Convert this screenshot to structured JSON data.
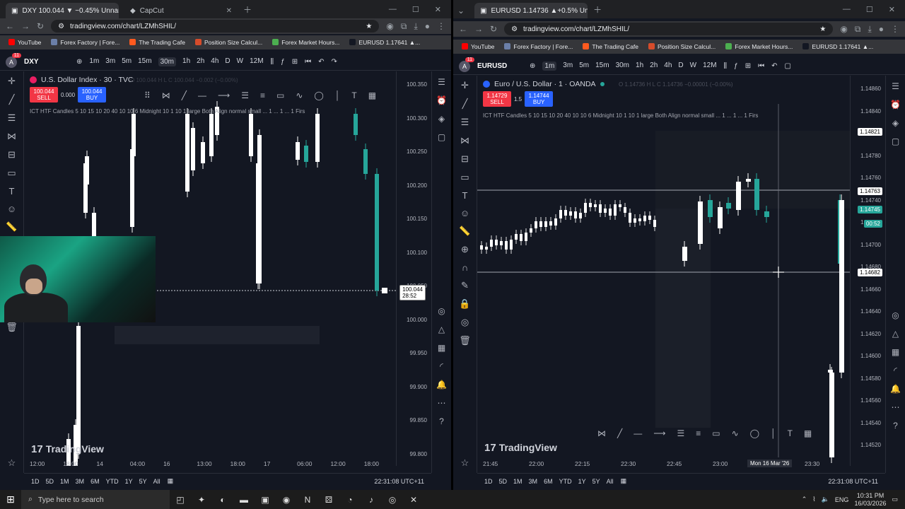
{
  "left": {
    "tab_title": "DXY 100.044 ▼ −0.45% Unnam",
    "tab2_title": "CapCut",
    "url": "tradingview.com/chart/LZMhSHIL/",
    "bookmarks": [
      "YouTube",
      "Forex Factory | Fore...",
      "The Trading Cafe",
      "Position Size Calcul...",
      "Forex Market Hours...",
      "EURUSD 1.17641 ▲..."
    ],
    "symbol": "DXY",
    "timeframes": [
      "1m",
      "3m",
      "5m",
      "15m",
      "30m",
      "1h",
      "2h",
      "4h",
      "D",
      "W",
      "12M"
    ],
    "active_tf": "30m",
    "title": "U.S. Dollar Index · 30 · TVC",
    "sell_price": "100.044",
    "sell_label": "SELL",
    "spread": "0.000",
    "buy_price": "100.044",
    "buy_label": "BUY",
    "ohlc": "O 100.044  H  L  C 100.044 −0.002 (−0.00%)",
    "indicator": "ICT HTF Candles   5 10 15 10 20 40 10 10 6 Midnight 10 1 10 1 large Both Align normal small ... 1 ... 1 ... 1 Firs",
    "price_scale": [
      "100.350",
      "100.300",
      "100.250",
      "100.200",
      "100.150",
      "100.100",
      "100.050",
      "100.000",
      "99.950",
      "99.900",
      "99.850",
      "99.800"
    ],
    "last_price": "100.044",
    "countdown": "28:52",
    "x_labels": [
      "12:00",
      "18:00",
      "14",
      "04:00",
      "16",
      "13:00",
      "18:00",
      "17",
      "06:00",
      "12:00",
      "18:00"
    ],
    "ranges": [
      "1D",
      "5D",
      "1M",
      "3M",
      "6M",
      "YTD",
      "1Y",
      "5Y",
      "All"
    ],
    "time": "22:31:08 UTC+11",
    "logo": "TradingView"
  },
  "right": {
    "tab_title": "EURUSD 1.14736 ▲+0.5% Unna",
    "url": "tradingview.com/chart/LZMhSHIL/",
    "bookmarks": [
      "YouTube",
      "Forex Factory | Fore...",
      "The Trading Cafe",
      "Position Size Calcul...",
      "Forex Market Hours...",
      "EURUSD 1.17641 ▲..."
    ],
    "symbol": "EURUSD",
    "timeframes": [
      "1m",
      "3m",
      "5m",
      "15m",
      "30m",
      "1h",
      "2h",
      "4h",
      "D",
      "W",
      "12M"
    ],
    "active_tf": "1m",
    "title": "Euro / U.S. Dollar · 1 · OANDA",
    "sell_price": "1.14729",
    "sell_label": "SELL",
    "spread": "1.5",
    "buy_price": "1.14744",
    "buy_label": "BUY",
    "ohlc": "O 1.14736  H  L  C 1.14736 −0.00001 (−0.00%)",
    "indicator": "ICT HTF Candles   5 10 15 10 20 40 10 10 6 Midnight 10 1 10 1 large Both Align normal small ... 1 ... 1 ... 1 Firs",
    "price_scale": [
      "1.14860",
      "1.14840",
      "1.14800",
      "1.14780",
      "1.14760",
      "1.14740",
      "1.14720",
      "1.14700",
      "1.14680",
      "1.14660",
      "1.14640",
      "1.14620",
      "1.14600",
      "1.14580",
      "1.14560",
      "1.14540",
      "1.14520"
    ],
    "tags": {
      "high": "1.14821",
      "mid": "1.14763",
      "last": "1.14745",
      "countdown": "00:52",
      "cursor": "1.14682"
    },
    "x_labels": [
      "21:45",
      "22:00",
      "22:15",
      "22:30",
      "22:45",
      "23:00",
      "23:13",
      "23:30"
    ],
    "cursor_date": "Mon 16 Mar '26",
    "ranges": [
      "1D",
      "5D",
      "1M",
      "3M",
      "6M",
      "YTD",
      "1Y",
      "5Y",
      "All"
    ],
    "time": "22:31:08 UTC+11",
    "logo": "TradingView"
  },
  "taskbar": {
    "search_placeholder": "Type here to search",
    "lang": "ENG",
    "clock_time": "10:31 PM",
    "clock_date": "16/03/2026"
  },
  "colors": {
    "bg": "#131722",
    "up": "#26a69a",
    "down": "#ffffff",
    "sell": "#f23645",
    "buy": "#2962ff"
  }
}
